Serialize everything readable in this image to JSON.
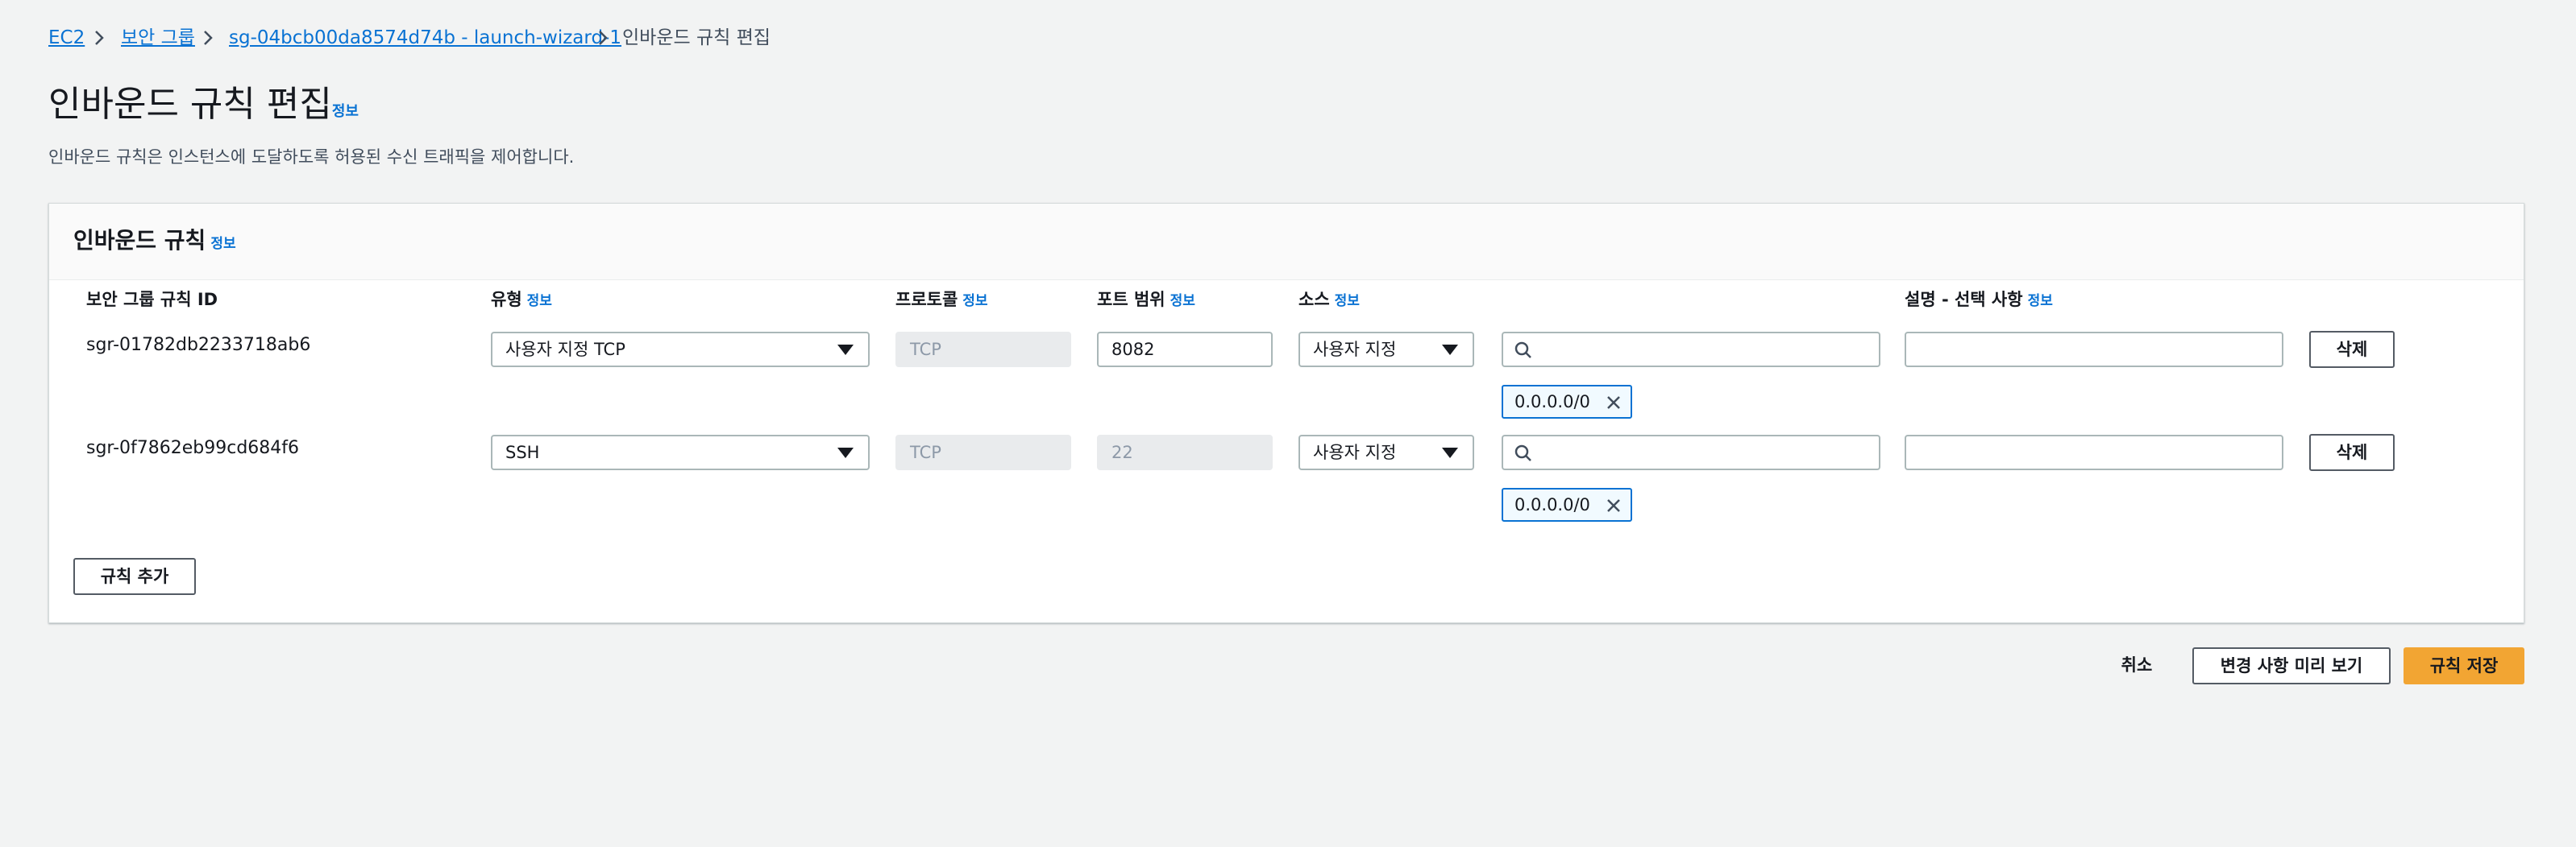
{
  "breadcrumb": {
    "items": [
      "EC2",
      "보안 그룹",
      "sg-04bcb00da8574d74b - launch-wizard-1"
    ],
    "current": "인바운드 규칙 편집"
  },
  "page": {
    "title": "인바운드 규칙 편집",
    "info": "정보",
    "description": "인바운드 규칙은 인스턴스에 도달하도록 허용된 수신 트래픽을 제어합니다."
  },
  "panel": {
    "title": "인바운드 규칙",
    "info": "정보",
    "columns": {
      "rule_id": "보안 그룹 규칙 ID",
      "type": "유형",
      "protocol": "프로토콜",
      "port_range": "포트 범위",
      "source": "소스",
      "description": "설명 - 선택 사항"
    },
    "rows": [
      {
        "rule_id": "sgr-01782db2233718ab6",
        "type": "사용자 지정 TCP",
        "protocol": "TCP",
        "port": "8082",
        "source_type": "사용자 지정",
        "search_value": "",
        "token": "0.0.0.0/0",
        "description": "",
        "delete": "삭제"
      },
      {
        "rule_id": "sgr-0f7862eb99cd684f6",
        "type": "SSH",
        "protocol": "TCP",
        "port": "22",
        "source_type": "사용자 지정",
        "search_value": "",
        "token": "0.0.0.0/0",
        "description": "",
        "delete": "삭제"
      }
    ],
    "add_rule": "규칙 추가"
  },
  "footer": {
    "cancel": "취소",
    "preview": "변경 사항 미리 보기",
    "save": "규칙 저장"
  },
  "colors": {
    "link": "#0972d3",
    "primary_button": "#f2a533",
    "background": "#f2f3f3"
  },
  "icons": [
    "chevron-right-icon",
    "caret-down-icon",
    "search-icon",
    "close-icon"
  ]
}
